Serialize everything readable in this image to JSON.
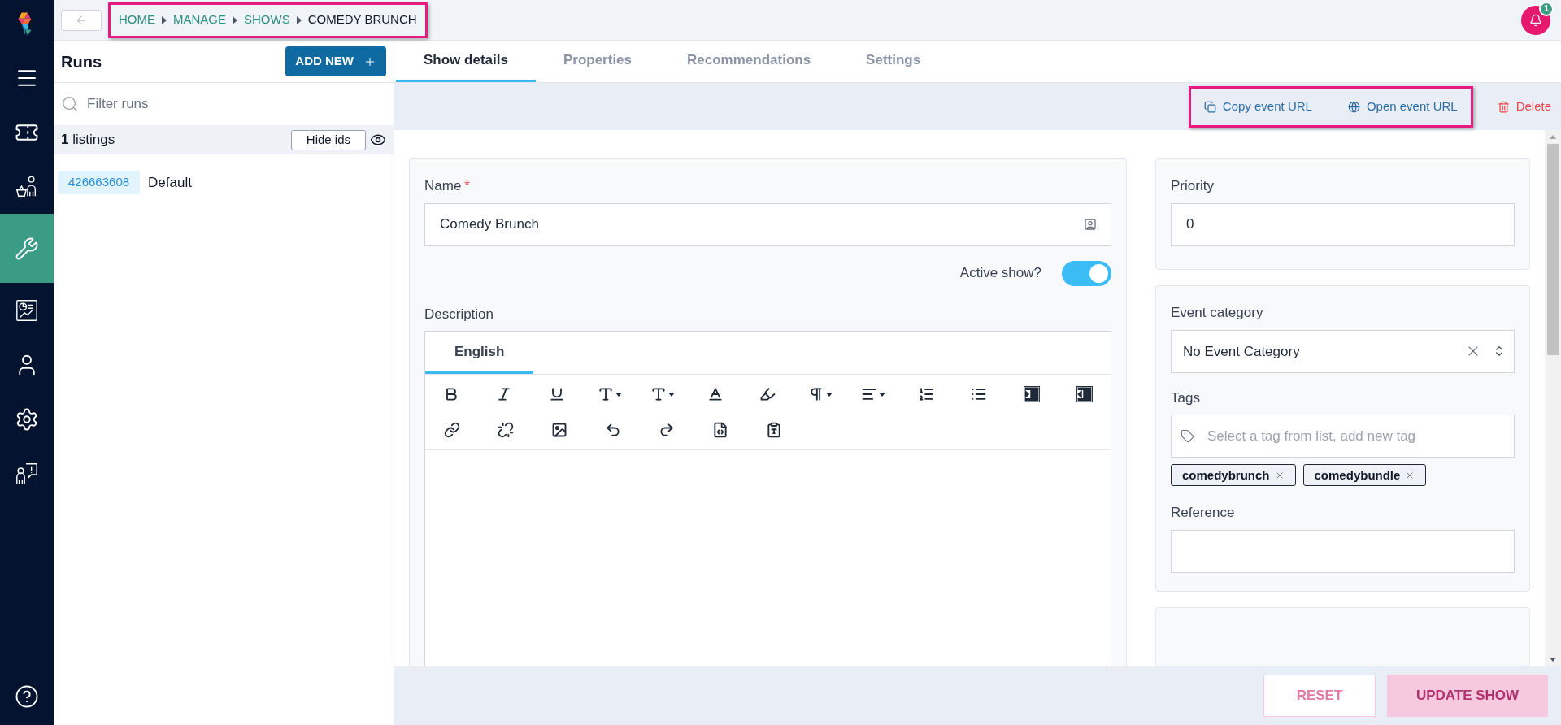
{
  "nav": {
    "items": [
      {
        "kind": "menu",
        "selected": false
      },
      {
        "kind": "ticket",
        "selected": false
      },
      {
        "kind": "customer",
        "selected": false
      },
      {
        "kind": "manage",
        "selected": true
      },
      {
        "kind": "reports",
        "selected": false
      },
      {
        "kind": "user",
        "selected": false
      },
      {
        "kind": "settings",
        "selected": false
      },
      {
        "kind": "support",
        "selected": false
      }
    ],
    "bottom": {
      "kind": "help",
      "selected": false
    }
  },
  "breadcrumb": {
    "highlighted": true,
    "items": [
      {
        "label": "HOME",
        "current": false
      },
      {
        "label": "MANAGE",
        "current": false
      },
      {
        "label": "SHOWS",
        "current": false
      },
      {
        "label": "COMEDY BRUNCH",
        "current": true
      }
    ]
  },
  "notifications": {
    "count": "1"
  },
  "runs_panel": {
    "title": "Runs",
    "add_button": "ADD NEW",
    "filter": {
      "placeholder": "Filter runs"
    },
    "count": "1",
    "count_label": "listings",
    "hide_ids_button": "Hide ids",
    "listings": [
      {
        "id": "426663608",
        "name": "Default"
      }
    ]
  },
  "tabs": [
    {
      "label": "Show details",
      "selected": true
    },
    {
      "label": "Properties",
      "selected": false
    },
    {
      "label": "Recommendations",
      "selected": false
    },
    {
      "label": "Settings",
      "selected": false
    }
  ],
  "actions": {
    "highlighted": true,
    "items": [
      {
        "kind": "copy",
        "label": "Copy event URL"
      },
      {
        "kind": "open",
        "label": "Open event URL"
      },
      {
        "kind": "delete",
        "label": "Delete"
      }
    ]
  },
  "form": {
    "name": {
      "label": "Name",
      "required_mark": "*",
      "value": "Comedy Brunch"
    },
    "active": {
      "label": "Active show?",
      "on": true
    },
    "description": {
      "label": "Description",
      "languages": [
        {
          "label": "English",
          "selected": true
        }
      ]
    },
    "priority": {
      "label": "Priority",
      "value": "0"
    },
    "event_category": {
      "label": "Event category",
      "value": "No Event Category"
    },
    "tags": {
      "label": "Tags",
      "placeholder": "Select a tag from list, add new tag",
      "items": [
        "comedybrunch",
        "comedybundle"
      ]
    },
    "reference": {
      "label": "Reference"
    }
  },
  "footer": {
    "reset": {
      "label": "RESET",
      "disabled": true
    },
    "update": {
      "label": "UPDATE SHOW",
      "disabled": true
    }
  }
}
